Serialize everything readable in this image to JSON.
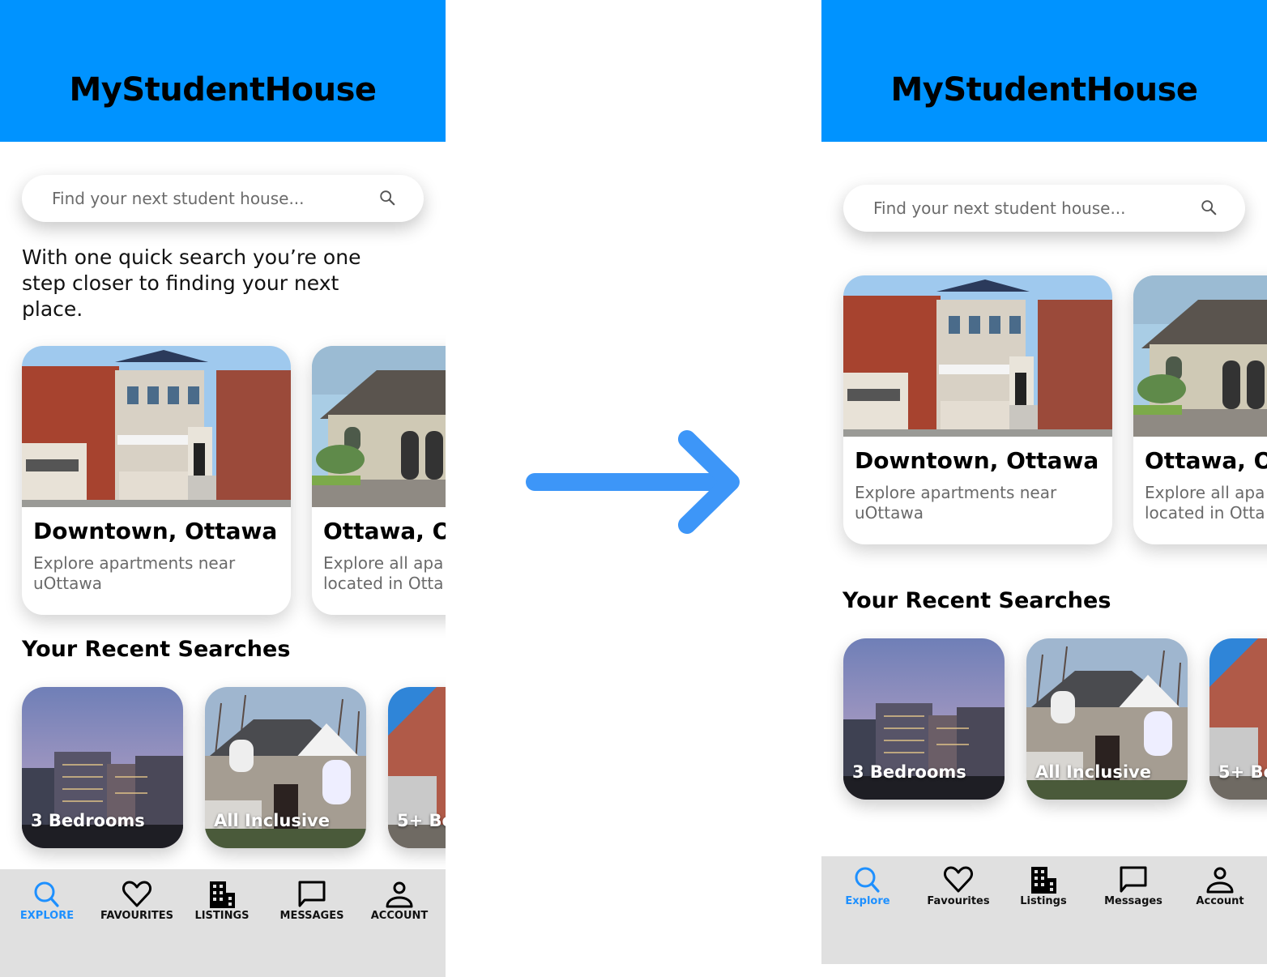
{
  "colors": {
    "brand": "#0093ff",
    "active_nav": "#1e90ff",
    "arrow": "#3d96f8",
    "navbar_bg": "#e0e0e0",
    "muted_text": "#6a6a6a"
  },
  "flow_arrow": {
    "icon": "arrow-right-icon"
  },
  "before": {
    "header": {
      "title": "MyStudentHouse"
    },
    "search": {
      "placeholder": "Find your next student house...",
      "icon": "search-icon"
    },
    "tagline": "With one quick search you’re one step closer to finding your next place.",
    "featured": [
      {
        "title": "Downtown, Ottawa",
        "desc_line1": "Explore apartments near",
        "desc_line2": "uOttawa"
      },
      {
        "title": "Ottawa, O",
        "desc_line1": "Explore all apa",
        "desc_line2": "located in Otta"
      }
    ],
    "recent_title": "Your Recent Searches",
    "recent": [
      {
        "label": "3 Bedrooms"
      },
      {
        "label": "All Inclusive"
      },
      {
        "label": "5+ Be"
      }
    ],
    "nav": [
      {
        "label": "EXPLORE",
        "icon": "search-icon",
        "active": true
      },
      {
        "label": "FAVOURITES",
        "icon": "heart-icon",
        "active": false
      },
      {
        "label": "LISTINGS",
        "icon": "building-icon",
        "active": false
      },
      {
        "label": "MESSAGES",
        "icon": "chat-bubble-icon",
        "active": false
      },
      {
        "label": "ACCOUNT",
        "icon": "person-icon",
        "active": false
      }
    ]
  },
  "after": {
    "header": {
      "title": "MyStudentHouse"
    },
    "search": {
      "placeholder": "Find your next student house...",
      "icon": "search-icon"
    },
    "featured": [
      {
        "title": "Downtown, Ottawa",
        "desc_line1": "Explore apartments near",
        "desc_line2": "uOttawa"
      },
      {
        "title": "Ottawa, O",
        "desc_line1": "Explore all apa",
        "desc_line2": "located in Otta"
      }
    ],
    "recent_title": "Your Recent Searches",
    "recent": [
      {
        "label": "3 Bedrooms"
      },
      {
        "label": "All Inclusive"
      },
      {
        "label": "5+ Be"
      }
    ],
    "nav": [
      {
        "label": "Explore",
        "icon": "search-icon",
        "active": true
      },
      {
        "label": "Favourites",
        "icon": "heart-icon",
        "active": false
      },
      {
        "label": "Listings",
        "icon": "building-icon",
        "active": false
      },
      {
        "label": "Messages",
        "icon": "chat-bubble-icon",
        "active": false
      },
      {
        "label": "Account",
        "icon": "person-icon",
        "active": false
      }
    ]
  }
}
